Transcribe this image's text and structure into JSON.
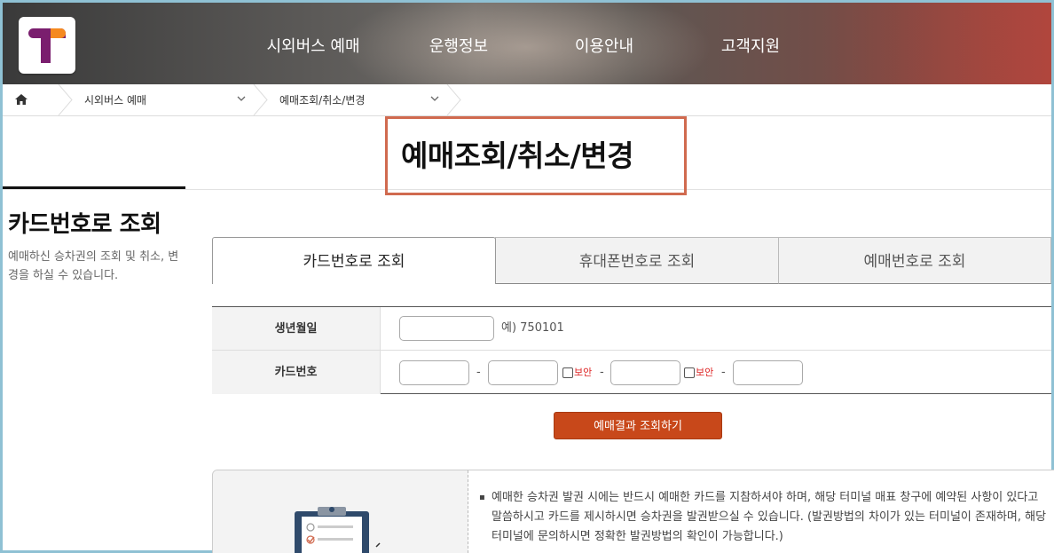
{
  "header": {
    "nav": [
      "시외버스 예매",
      "운행정보",
      "이용안내",
      "고객지원"
    ]
  },
  "breadcrumb": {
    "items": [
      "시외버스 예매",
      "예매조회/취소/변경"
    ]
  },
  "page_title": "예매조회/취소/변경",
  "sidebar": {
    "title": "카드번호로 조회",
    "description": "예매하신 승차권의 조회 및 취소, 변경을 하실 수 있습니다."
  },
  "tabs": [
    {
      "label": "카드번호로 조회",
      "active": true
    },
    {
      "label": "휴대폰번호로 조회",
      "active": false
    },
    {
      "label": "예매번호로 조회",
      "active": false
    }
  ],
  "form": {
    "birth_label": "생년월일",
    "birth_hint": "예) 750101",
    "card_label": "카드번호",
    "dash": "-",
    "secure_label": "보안"
  },
  "search_button": "예매결과 조회하기",
  "notice": {
    "bullet": "▪",
    "text": "예매한 승차권 발권 시에는 반드시 예매한 카드를 지참하셔야 하며, 해당 터미널 매표 창구에 예약된 사항이 있다고 말씀하시고 카드를 제시하시면 승차권을 발권받으실 수 있습니다. (발권방법의 차이가 있는 터미널이 존재하며, 해당 터미널에 문의하시면 정확한 발권방법의 확인이 가능합니다.)"
  },
  "colors": {
    "accent": "#c8481a",
    "title_border": "#d06a4f",
    "logo_purple": "#7a1e6e",
    "logo_orange": "#f5891f",
    "secure_red": "#dd2222"
  }
}
